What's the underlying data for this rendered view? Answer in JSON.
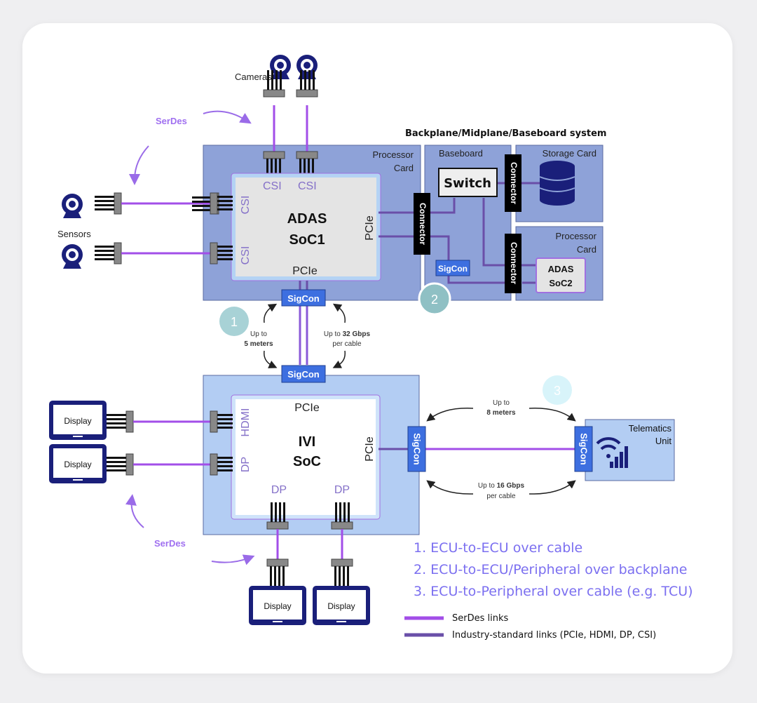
{
  "labels": {
    "cameras": "Cameras",
    "sensors": "Sensors",
    "serdes_top": "SerDes",
    "serdes_bottom": "SerDes",
    "backplane_title": "Backplane/Midplane/Baseboard system",
    "processor_card": "Processor",
    "processor_card2": "Card",
    "baseboard": "Baseboard",
    "storage_card": "Storage Card",
    "processor_card_b": "Processor",
    "processor_card_b2": "Card",
    "switch": "Switch",
    "connector": "Connector",
    "sigcon": "SigCon",
    "adas_soc1_a": "ADAS",
    "adas_soc1_b": "SoC1",
    "adas_soc2_a": "ADAS",
    "adas_soc2_b": "SoC2",
    "ivi_a": "IVI",
    "ivi_b": "SoC",
    "csi": "CSI",
    "pcie": "PCIe",
    "hdmi": "HDMI",
    "dp": "DP",
    "display": "Display",
    "telematics_a": "Telematics",
    "telematics_b": "Unit",
    "up_to": "Up to",
    "five_meters": "5 meters",
    "up_to_32": "Up to ",
    "gbps32": "32 Gbps",
    "per_cable": "per cable",
    "eight_meters": "8 meters",
    "up_to_16": "Up to ",
    "gbps16": "16 Gbps",
    "badge1": "1",
    "badge2": "2",
    "badge3": "3"
  },
  "list": [
    "1.  ECU-to-ECU over cable",
    "2.  ECU-to-ECU/Peripheral over backplane",
    "3.  ECU-to-Peripheral over cable (e.g. TCU)"
  ],
  "legend": [
    {
      "label": "SerDes  links",
      "color": "#a24ee8"
    },
    {
      "label": "Industry-standard links (PCIe, HDMI, DP, CSI)",
      "color": "#6a4fa8"
    }
  ],
  "colors": {
    "card_fill": "#8ea2d8",
    "sigcon": "#3d6fe0",
    "serdes": "#a24ee8",
    "standard": "#6a4fa8",
    "list_text": "#7b6ff0",
    "icon_navy": "#1a1f7a"
  }
}
